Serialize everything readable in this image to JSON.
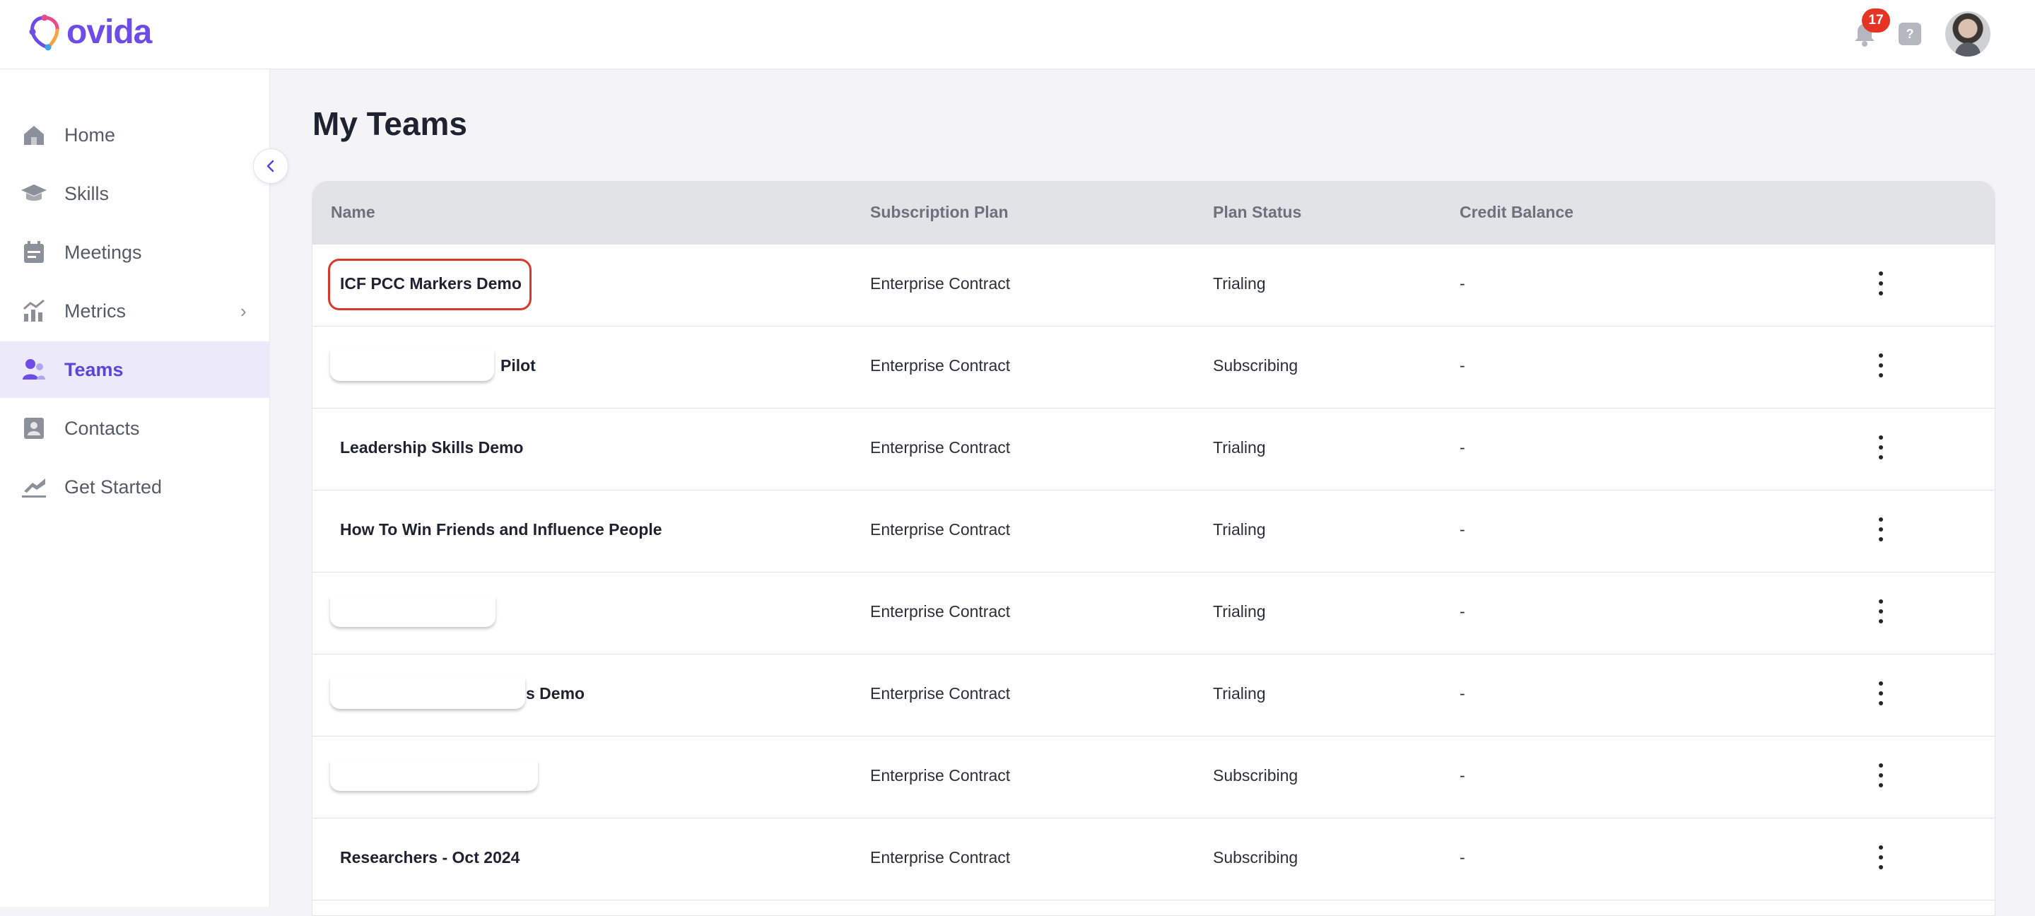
{
  "app": {
    "logo_text": "ovida",
    "brand_color": "#6d4ce8"
  },
  "header": {
    "notification_count": "17",
    "help_label": "?"
  },
  "sidebar": {
    "items": [
      {
        "label": "Home",
        "icon": "home-icon",
        "active": false
      },
      {
        "label": "Skills",
        "icon": "graduation-cap-icon",
        "active": false
      },
      {
        "label": "Meetings",
        "icon": "calendar-icon",
        "active": false
      },
      {
        "label": "Metrics",
        "icon": "chart-icon",
        "active": false,
        "has_submenu": true
      },
      {
        "label": "Teams",
        "icon": "team-icon",
        "active": true
      },
      {
        "label": "Contacts",
        "icon": "contact-card-icon",
        "active": false
      },
      {
        "label": "Get Started",
        "icon": "launch-icon",
        "active": false
      }
    ]
  },
  "main": {
    "title": "My Teams",
    "table": {
      "columns": [
        "Name",
        "Subscription Plan",
        "Plan Status",
        "Credit Balance"
      ],
      "rows": [
        {
          "name": "ICF PCC Markers Demo",
          "plan": "Enterprise Contract",
          "status": "Trialing",
          "credit": "-"
        },
        {
          "name": "Pilot",
          "plan": "Enterprise Contract",
          "status": "Subscribing",
          "credit": "-"
        },
        {
          "name": "Leadership Skills Demo",
          "plan": "Enterprise Contract",
          "status": "Trialing",
          "credit": "-"
        },
        {
          "name": "How To Win Friends and Influence People",
          "plan": "Enterprise Contract",
          "status": "Trialing",
          "credit": "-"
        },
        {
          "name": "",
          "plan": "Enterprise Contract",
          "status": "Trialing",
          "credit": "-"
        },
        {
          "name": "s Demo",
          "plan": "Enterprise Contract",
          "status": "Trialing",
          "credit": "-"
        },
        {
          "name": "",
          "plan": "Enterprise Contract",
          "status": "Subscribing",
          "credit": "-"
        },
        {
          "name": "Researchers - Oct 2024",
          "plan": "Enterprise Contract",
          "status": "Subscribing",
          "credit": "-"
        }
      ]
    }
  }
}
